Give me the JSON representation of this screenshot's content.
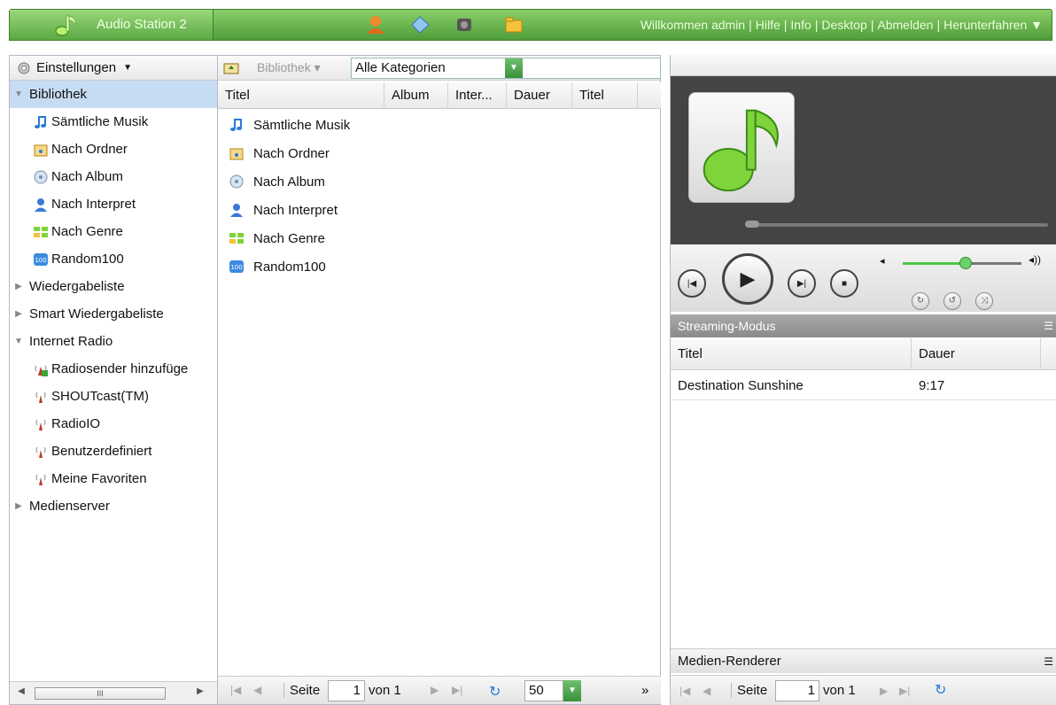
{
  "header": {
    "app_title": "Audio Station 2",
    "links": [
      "Willkommen admin",
      "Hilfe",
      "Info",
      "Desktop",
      "Abmelden",
      "Herunterfahren ▼"
    ]
  },
  "sidebar": {
    "settings_label": "Einstellungen",
    "items": [
      {
        "label": "Bibliothek",
        "level": 0,
        "expanded": true,
        "selected": true
      },
      {
        "label": "Sämtliche Musik",
        "level": 1,
        "icon": "music-note-icon"
      },
      {
        "label": "Nach Ordner",
        "level": 1,
        "icon": "folder-music-icon"
      },
      {
        "label": "Nach Album",
        "level": 1,
        "icon": "album-disc-icon"
      },
      {
        "label": "Nach Interpret",
        "level": 1,
        "icon": "person-icon"
      },
      {
        "label": "Nach Genre",
        "level": 1,
        "icon": "genre-grid-icon"
      },
      {
        "label": "Random100",
        "level": 1,
        "icon": "random100-icon"
      },
      {
        "label": "Wiedergabeliste",
        "level": 0,
        "expanded": false
      },
      {
        "label": "Smart Wiedergabeliste",
        "level": 0,
        "expanded": false
      },
      {
        "label": "Internet Radio",
        "level": 0,
        "expanded": true
      },
      {
        "label": "Radiosender hinzufüge",
        "level": 1,
        "icon": "radio-add-icon"
      },
      {
        "label": "SHOUTcast(TM)",
        "level": 1,
        "icon": "radio-antenna-icon"
      },
      {
        "label": "RadioIO",
        "level": 1,
        "icon": "radio-antenna-icon"
      },
      {
        "label": "Benutzerdefiniert",
        "level": 1,
        "icon": "radio-antenna-icon"
      },
      {
        "label": "Meine Favoriten",
        "level": 1,
        "icon": "radio-antenna-icon"
      },
      {
        "label": "Medienserver",
        "level": 0,
        "expanded": false
      }
    ]
  },
  "center": {
    "library_menu": "Bibliothek",
    "category_value": "Alle Kategorien",
    "columns": [
      "Titel",
      "Album",
      "Inter...",
      "Dauer",
      "Titel"
    ],
    "rows": [
      {
        "label": "Sämtliche Musik",
        "icon": "music-note-icon"
      },
      {
        "label": "Nach Ordner",
        "icon": "folder-music-icon"
      },
      {
        "label": "Nach Album",
        "icon": "album-disc-icon"
      },
      {
        "label": "Nach Interpret",
        "icon": "person-icon"
      },
      {
        "label": "Nach Genre",
        "icon": "genre-grid-icon"
      },
      {
        "label": "Random100",
        "icon": "random100-icon"
      }
    ],
    "pager": {
      "page_label": "Seite",
      "page": "1",
      "of_label": "von 1",
      "page_size": "50",
      "more": "»"
    }
  },
  "player": {
    "streaming_label": "Streaming-Modus",
    "columns": [
      "Titel",
      "Dauer"
    ],
    "playlist": [
      {
        "title": "Destination Sunshine",
        "duration": "9:17"
      }
    ],
    "renderer_label": "Medien-Renderer",
    "pager": {
      "page_label": "Seite",
      "page": "1",
      "of_label": "von 1"
    },
    "volume_level": 0.55,
    "progress_level": 0.0
  },
  "colors": {
    "header_green": "#5aa944",
    "selected_row": "#c6dcf3",
    "accent_green": "#47c747"
  }
}
